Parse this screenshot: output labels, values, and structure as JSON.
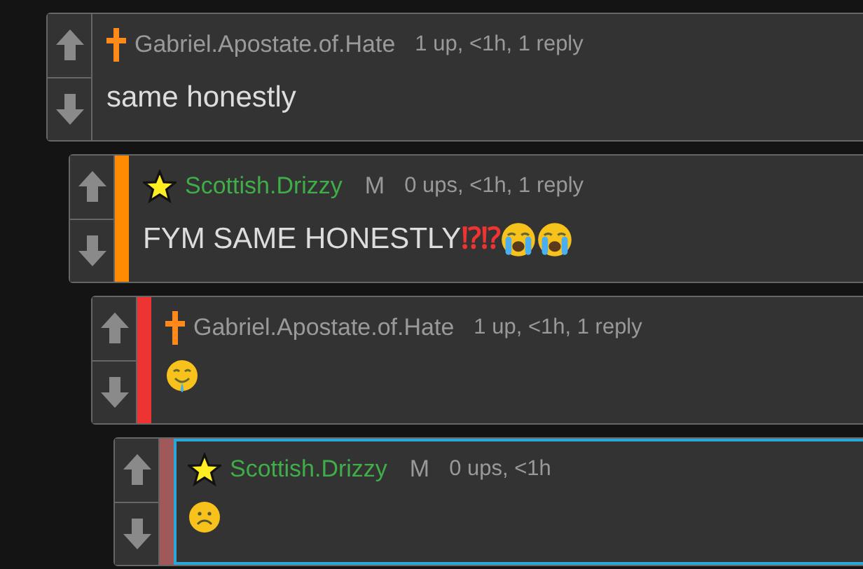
{
  "comments": [
    {
      "author": {
        "badge": {
          "kind": "cross"
        },
        "name": "Gabriel.Apostate.of.Hate",
        "color": "#9a9a9a"
      },
      "meta": "1 up, <1h, 1 reply",
      "highlighted": false,
      "body": [
        {
          "kind": "text",
          "text": "same honestly"
        }
      ],
      "children": [
        {
          "author": {
            "badge": {
              "kind": "star"
            },
            "name": "Scottish.Drizzy",
            "color": "#3fae49",
            "gender": "M"
          },
          "meta": "0 ups, <1h, 1 reply",
          "highlighted": false,
          "bar": {
            "color": "#ff8c00"
          },
          "body": [
            {
              "kind": "text",
              "text": "FYM SAME HONESTLY"
            },
            {
              "kind": "mark",
              "text": "⁉"
            },
            {
              "kind": "mark",
              "text": "⁉"
            },
            {
              "kind": "crying"
            },
            {
              "kind": "crying"
            }
          ],
          "children": [
            {
              "author": {
                "badge": {
                  "kind": "cross"
                },
                "name": "Gabriel.Apostate.of.Hate",
                "color": "#9a9a9a"
              },
              "meta": "1 up, <1h, 1 reply",
              "highlighted": false,
              "bar": {
                "color": "#ee3333"
              },
              "body": [
                {
                  "kind": "drooling"
                }
              ],
              "children": [
                {
                  "author": {
                    "badge": {
                      "kind": "star"
                    },
                    "name": "Scottish.Drizzy",
                    "color": "#3fae49",
                    "gender": "M"
                  },
                  "meta": "0 ups, <1h",
                  "highlighted": true,
                  "bar": {
                    "color": "#a05858"
                  },
                  "body": [
                    {
                      "kind": "frowning"
                    }
                  ]
                }
              ]
            }
          ]
        }
      ]
    }
  ]
}
